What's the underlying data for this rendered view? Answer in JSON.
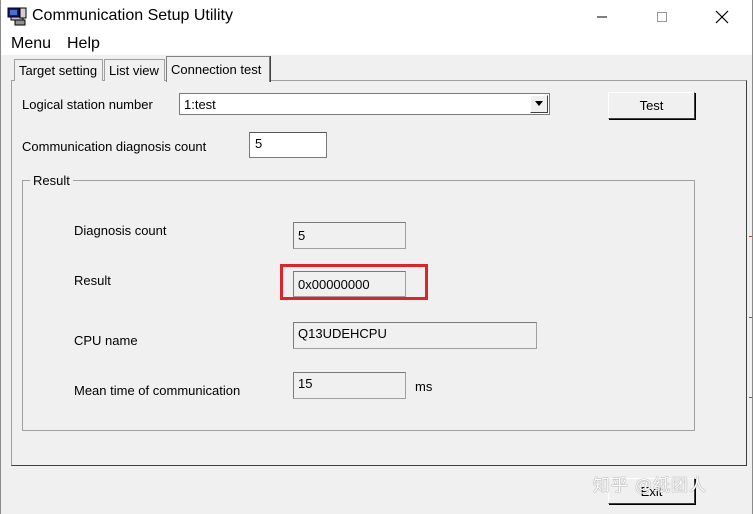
{
  "window": {
    "title": "Communication Setup Utility",
    "controls": {
      "minimize": "—",
      "maximize": "☐",
      "close": "✕"
    }
  },
  "menubar": {
    "items": [
      "Menu",
      "Help"
    ]
  },
  "tabs": [
    {
      "label": "Target setting",
      "active": false
    },
    {
      "label": "List view",
      "active": false
    },
    {
      "label": "Connection test",
      "active": true
    }
  ],
  "connection_test": {
    "logical_station_label": "Logical station number",
    "logical_station_value": "1:test",
    "test_button": "Test",
    "diagnosis_count_label": "Communication diagnosis count",
    "diagnosis_count_value": "5",
    "result_group": {
      "title": "Result",
      "diagnosis_count_label": "Diagnosis count",
      "diagnosis_count_value": "5",
      "result_label": "Result",
      "result_value": "0x00000000",
      "cpu_name_label": "CPU name",
      "cpu_name_value": "Q13UDEHCPU",
      "mean_time_label": "Mean time of communication",
      "mean_time_value": "15",
      "mean_time_unit": "ms"
    }
  },
  "footer": {
    "exit_button": "Exit"
  },
  "watermark": "知乎 @纸团人",
  "colors": {
    "highlight": "#d9262b",
    "window_bg": "#f0f0f0"
  }
}
